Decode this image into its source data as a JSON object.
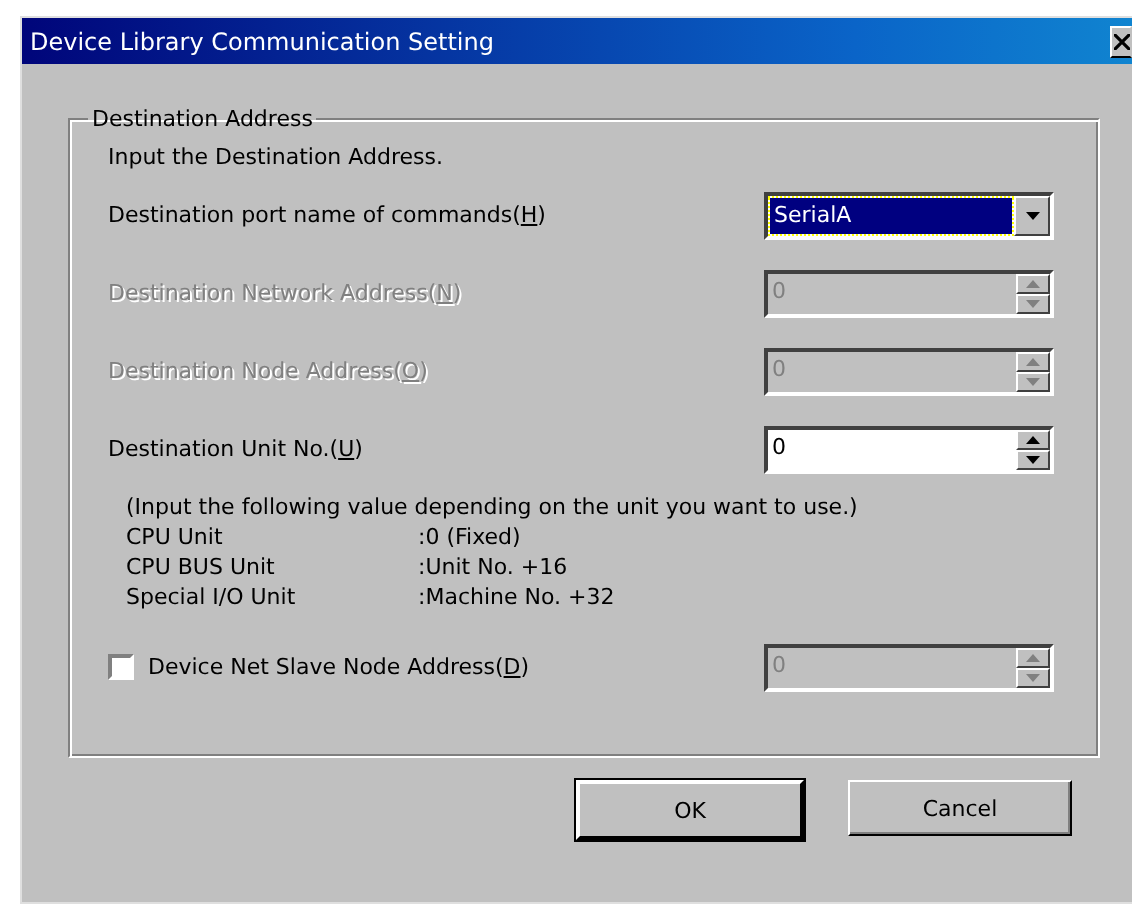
{
  "window": {
    "title": "Device Library Communication Setting"
  },
  "group": {
    "title": "Destination Address",
    "intro": "Input the Destination Address.",
    "fields": [
      {
        "kind": "select",
        "label": "Destination port name of commands(",
        "mnemonic": "H",
        "label_end": ")",
        "value": "SerialA",
        "disabled": false
      },
      {
        "kind": "spin",
        "label": "Destination Network Address(",
        "mnemonic": "N",
        "label_end": ")",
        "value": "0",
        "disabled": true
      },
      {
        "kind": "spin",
        "label": "Destination Node Address(",
        "mnemonic": "O",
        "label_end": ")",
        "value": "0",
        "disabled": true
      },
      {
        "kind": "spin",
        "label": "Destination Unit No.(",
        "mnemonic": "U",
        "label_end": ")",
        "value": "0",
        "disabled": false
      }
    ],
    "note": "(Input the following value depending on the unit you want to use.)",
    "units": [
      {
        "name": "CPU Unit",
        "value": ":0 (Fixed)"
      },
      {
        "name": "CPU BUS Unit",
        "value": ":Unit No. +16"
      },
      {
        "name": "Special I/O Unit",
        "value": ":Machine No. +32"
      }
    ],
    "devicenet": {
      "label": "Device Net Slave Node Address(",
      "mnemonic": "D",
      "label_end": ")",
      "checked": false,
      "value": "0",
      "disabled": true
    }
  },
  "buttons": [
    {
      "label": "OK",
      "default": true
    },
    {
      "label": "Cancel",
      "default": false
    }
  ]
}
